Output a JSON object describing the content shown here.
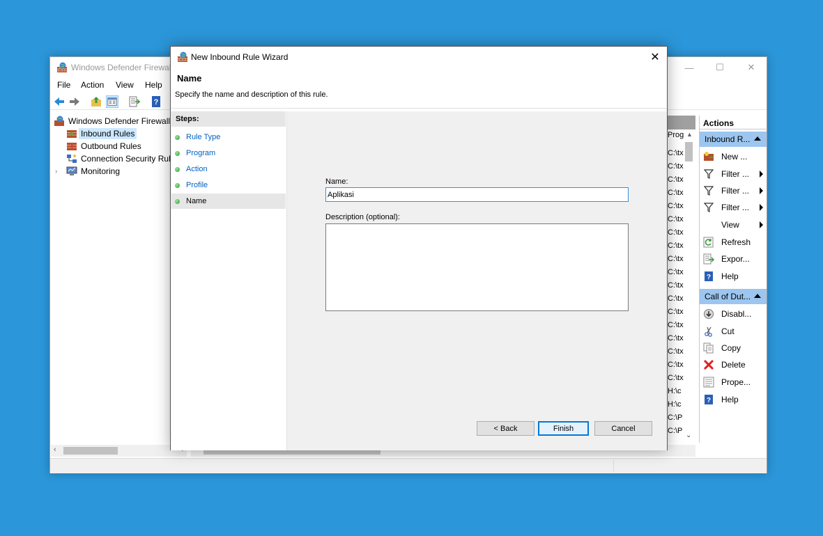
{
  "main_window": {
    "title": "Windows Defender Firewall",
    "controls": {
      "minimize": "—",
      "maximize": "☐",
      "close": "✕"
    },
    "menu": [
      "File",
      "Action",
      "View",
      "Help"
    ],
    "tree": {
      "root": "Windows Defender Firewall w",
      "items": [
        "Inbound Rules",
        "Outbound Rules",
        "Connection Security Rul",
        "Monitoring"
      ]
    },
    "list_fragments": {
      "header_sub": "Prog",
      "cells": [
        "C:\\tx",
        "C:\\tx",
        "C:\\tx",
        "C:\\tx",
        "C:\\tx",
        "C:\\tx",
        "C:\\tx",
        "C:\\tx",
        "C:\\tx",
        "C:\\tx",
        "C:\\tx",
        "C:\\tx",
        "C:\\tx",
        "C:\\tx",
        "C:\\tx",
        "C:\\tx",
        "C:\\tx",
        "C:\\tx",
        "H:\\c",
        "H:\\c",
        "C:\\P",
        "C:\\P"
      ]
    }
  },
  "actions": {
    "header": "Actions",
    "group1": "Inbound R...",
    "group1_items": [
      "New ...",
      "Filter ...",
      "Filter ...",
      "Filter ...",
      "View",
      "Refresh",
      "Expor...",
      "Help"
    ],
    "group2": "Call of Dut...",
    "group2_items": [
      "Disabl...",
      "Cut",
      "Copy",
      "Delete",
      "Prope...",
      "Help"
    ]
  },
  "wizard": {
    "title": "New Inbound Rule Wizard",
    "close": "✕",
    "page_title": "Name",
    "page_desc": "Specify the name and description of this rule.",
    "steps_header": "Steps:",
    "steps": [
      "Rule Type",
      "Program",
      "Action",
      "Profile",
      "Name"
    ],
    "current_step": "Name",
    "name_label": "Name:",
    "name_value": "Aplikasi",
    "description_label": "Description (optional):",
    "description_value": "",
    "buttons": {
      "back": "< Back",
      "finish": "Finish",
      "cancel": "Cancel"
    }
  }
}
